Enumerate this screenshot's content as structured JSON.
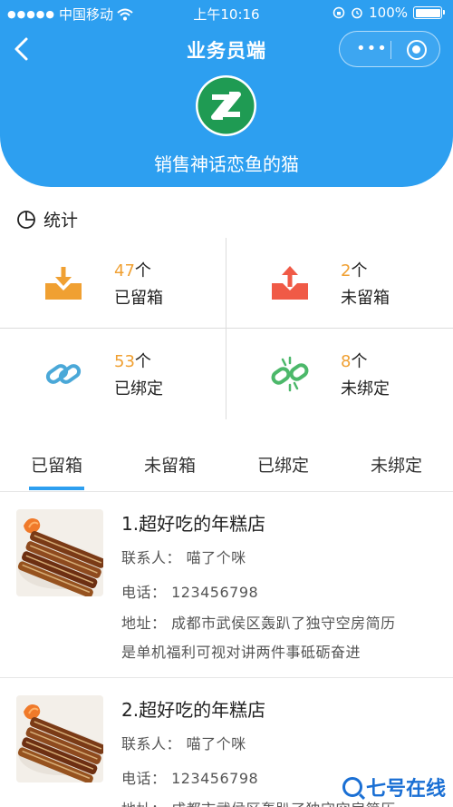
{
  "status_bar": {
    "carrier": "中国移动",
    "time": "上午10:16",
    "battery": "100%"
  },
  "nav": {
    "title": "业务员端",
    "more": "•••"
  },
  "profile": {
    "shop_name": "销售神话恋鱼的猫"
  },
  "stats": {
    "title": "统计",
    "items": [
      {
        "count": "47",
        "unit": "个",
        "label": "已留箱",
        "icon": "box-download-icon",
        "color": "#f0a032"
      },
      {
        "count": "2",
        "unit": "个",
        "label": "未留箱",
        "icon": "box-upload-icon",
        "color": "#f05a46"
      },
      {
        "count": "53",
        "unit": "个",
        "label": "已绑定",
        "icon": "link-icon",
        "color": "#4aa8d8"
      },
      {
        "count": "8",
        "unit": "个",
        "label": "未绑定",
        "icon": "broken-link-icon",
        "color": "#4cb86a"
      }
    ]
  },
  "tabs": [
    "已留箱",
    "未留箱",
    "已绑定",
    "未绑定"
  ],
  "list": [
    {
      "title": "1.超好吃的年糕店",
      "contact": "联系人：  喵了个咪",
      "phone": "电话：  123456798",
      "address_1": "地址：  成都市武侯区轰趴了独守空房简历",
      "address_2": "是单机福利可视对讲两件事砥砺奋进"
    },
    {
      "title": "2.超好吃的年糕店",
      "contact": "联系人：  喵了个咪",
      "phone": "电话：  123456798",
      "address_1": "地址：  成都市武侯区轰趴了独守空房简历"
    }
  ],
  "watermark": "七号在线",
  "accent_color": "#2d9ff0"
}
